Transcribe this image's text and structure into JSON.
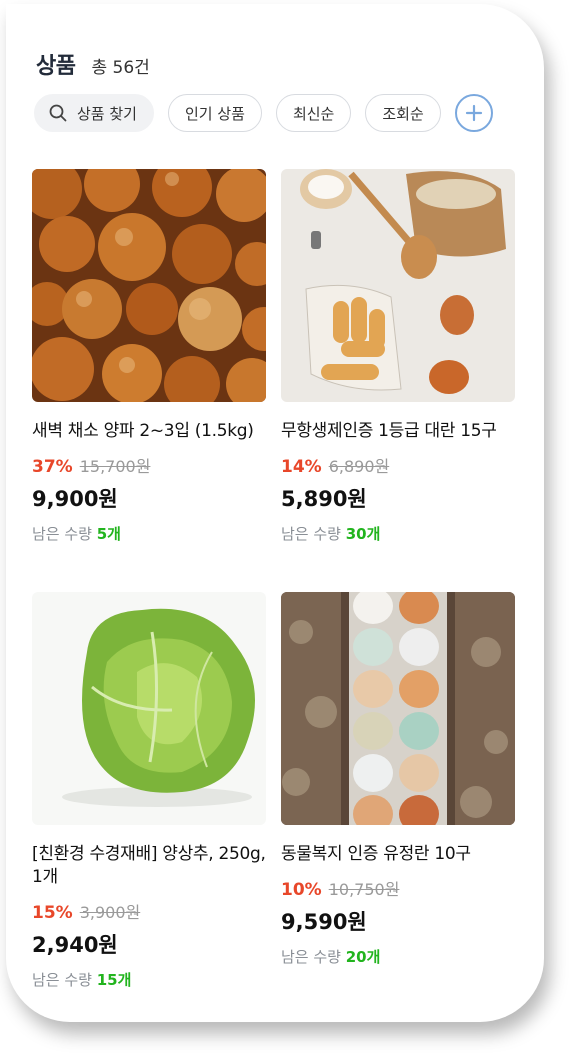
{
  "header": {
    "title": "상품",
    "count": "총 56건"
  },
  "filters": {
    "search_label": "상품 찾기",
    "chips": [
      "인기 상품",
      "최신순",
      "조회순"
    ]
  },
  "products": [
    {
      "name": "새벽 채소 양파 2~3입 (1.5kg)",
      "discount": "37%",
      "original_price": "15,700원",
      "price": "9,900원",
      "stock_label": "남은 수량",
      "stock": "5개",
      "image": "onion-photo"
    },
    {
      "name": "무항생제인증 1등급 대란 15구",
      "discount": "14%",
      "original_price": "6,890원",
      "price": "5,890원",
      "stock_label": "남은 수량",
      "stock": "30개",
      "image": "eggs-kitchen-photo"
    },
    {
      "name": "[친환경 수경재배] 양상추, 250g, 1개",
      "discount": "15%",
      "original_price": "3,900원",
      "price": "2,940원",
      "stock_label": "남은 수량",
      "stock": "15개",
      "image": "lettuce-photo"
    },
    {
      "name": "동물복지 인증 유정란 10구",
      "discount": "10%",
      "original_price": "10,750원",
      "price": "9,590원",
      "stock_label": "남은 수량",
      "stock": "20개",
      "image": "egg-carton-photo"
    }
  ],
  "colors": {
    "discount": "#e8472a",
    "stock": "#22b41e",
    "add_button": "#7aa8de"
  },
  "icons": {
    "search": "search-icon",
    "add": "plus-circle-icon"
  }
}
